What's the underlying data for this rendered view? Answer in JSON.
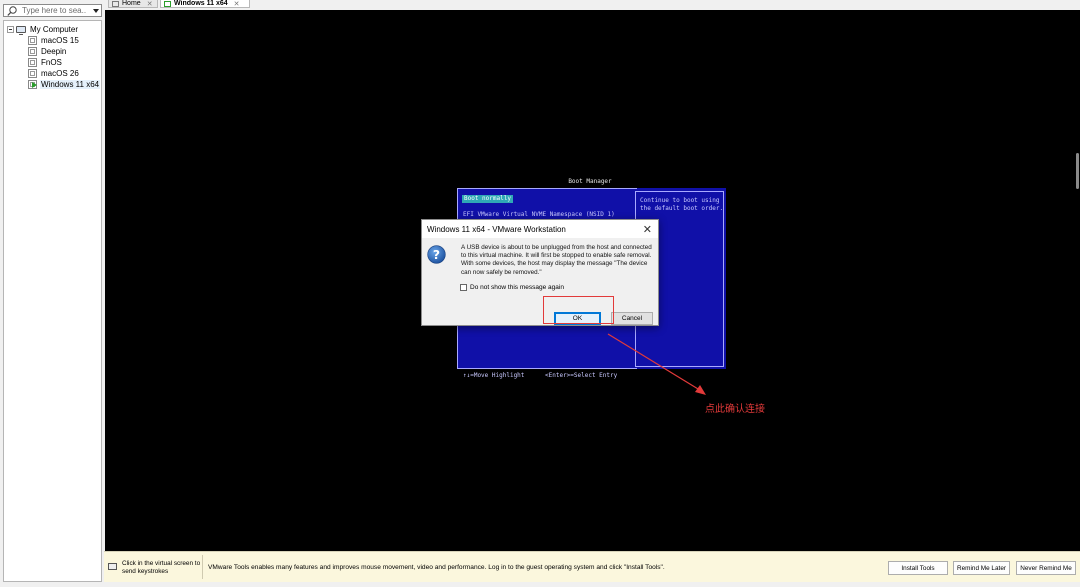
{
  "sidebar": {
    "search_placeholder": "Type here to sea...",
    "root": {
      "label": "My Computer"
    },
    "vms": [
      {
        "label": "macOS 15",
        "running": false
      },
      {
        "label": "Deepin",
        "running": false
      },
      {
        "label": "FnOS",
        "running": false
      },
      {
        "label": "macOS 26",
        "running": false
      },
      {
        "label": "Windows 11 x64",
        "running": true
      }
    ]
  },
  "tabs": [
    {
      "label": "Home",
      "active": false
    },
    {
      "label": "Windows 11 x64",
      "active": true
    }
  ],
  "boot_manager": {
    "title": "Boot Manager",
    "selected_entry": "Boot normally",
    "entries": [
      "EFI VMware Virtual NVME Namespace (NSID 1)"
    ],
    "help_text": "Continue to boot using the default boot order.",
    "footer_nav": "↑↓=Move Highlight",
    "footer_select": "<Enter>=Select Entry",
    "colors": {
      "background": "#1010a8",
      "highlight": "#2fa8b6"
    }
  },
  "dialog": {
    "title": "Windows 11 x64 - VMware Workstation",
    "icon": "question-icon",
    "message": "A USB device is about to be unplugged from the host and connected to this virtual machine. It will first be stopped to enable safe removal. With some devices, the host may display the message \"The device can now safely be removed.\"",
    "checkbox_label": "Do not show this message again",
    "checkbox_checked": false,
    "ok_label": "OK",
    "cancel_label": "Cancel"
  },
  "annotation": {
    "note": "点此确认连接",
    "color": "#e23a3a"
  },
  "notification": {
    "click_hint": "Click in the virtual screen to send keystrokes",
    "message": "VMware Tools enables many features and improves mouse movement, video and performance. Log in to the guest operating system and click \"Install Tools\".",
    "install_label": "Install Tools",
    "remind_label": "Remind Me Later",
    "never_label": "Never Remind Me"
  }
}
